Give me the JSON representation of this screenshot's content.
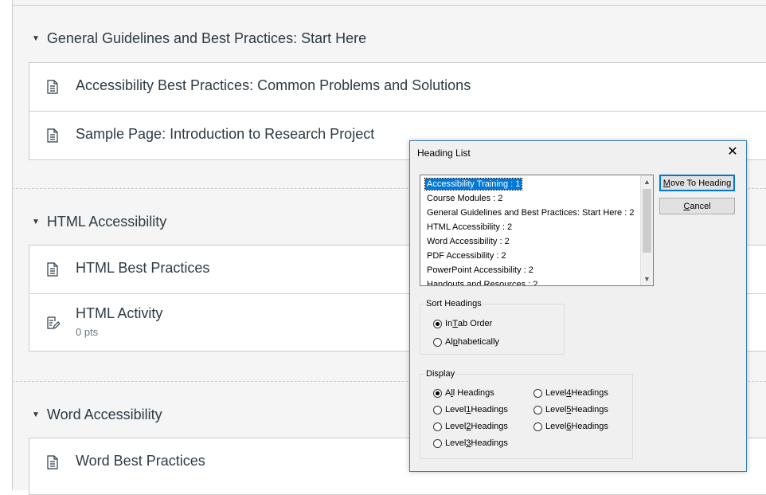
{
  "modules": [
    {
      "title": "General Guidelines and Best Practices: Start Here",
      "items": [
        {
          "title": "Accessibility Best Practices: Common Problems and Solutions",
          "icon": "page-icon"
        },
        {
          "title": "Sample Page: Introduction to Research Project",
          "icon": "page-icon"
        }
      ]
    },
    {
      "title": "HTML Accessibility",
      "items": [
        {
          "title": "HTML Best Practices",
          "icon": "page-icon"
        },
        {
          "title": "HTML Activity",
          "sub": "0 pts",
          "icon": "assignment-icon"
        }
      ]
    },
    {
      "title": "Word Accessibility",
      "items": [
        {
          "title": "Word Best Practices",
          "icon": "page-icon"
        }
      ]
    }
  ],
  "dialog": {
    "title": "Heading List",
    "close": "✕",
    "headings": [
      "Accessibility Training : 1",
      "Course Modules : 2",
      "General Guidelines and Best Practices: Start Here : 2",
      "HTML Accessibility : 2",
      "Word Accessibility : 2",
      "PDF Accessibility : 2",
      "PowerPoint Accessibility : 2",
      "Handouts and Resources : 2"
    ],
    "selected_index": 0,
    "move_button": {
      "pre": "",
      "key": "M",
      "post": "ove To Heading"
    },
    "cancel_button": {
      "pre": "",
      "key": "C",
      "post": "ancel"
    },
    "sort": {
      "label": "Sort Headings",
      "options": [
        {
          "pre": "In ",
          "key": "T",
          "post": "ab Order",
          "checked": true
        },
        {
          "pre": "Al",
          "key": "p",
          "post": "habetically",
          "checked": false
        }
      ]
    },
    "display": {
      "label": "Display",
      "options": [
        {
          "pre": "A",
          "key": "l",
          "post": "l Headings",
          "checked": true
        },
        {
          "pre": "Level ",
          "key": "1",
          "post": " Headings",
          "checked": false
        },
        {
          "pre": "Level ",
          "key": "2",
          "post": " Headings",
          "checked": false
        },
        {
          "pre": "Level ",
          "key": "3",
          "post": " Headings",
          "checked": false
        },
        {
          "pre": "Level ",
          "key": "4",
          "post": " Headings",
          "checked": false
        },
        {
          "pre": "Level ",
          "key": "5",
          "post": " Headings",
          "checked": false
        },
        {
          "pre": "Level ",
          "key": "6",
          "post": " Headings",
          "checked": false
        }
      ]
    }
  },
  "colors": {
    "accent": "#0078d7",
    "text": "#2d3b45",
    "border": "#c7cdd1"
  }
}
